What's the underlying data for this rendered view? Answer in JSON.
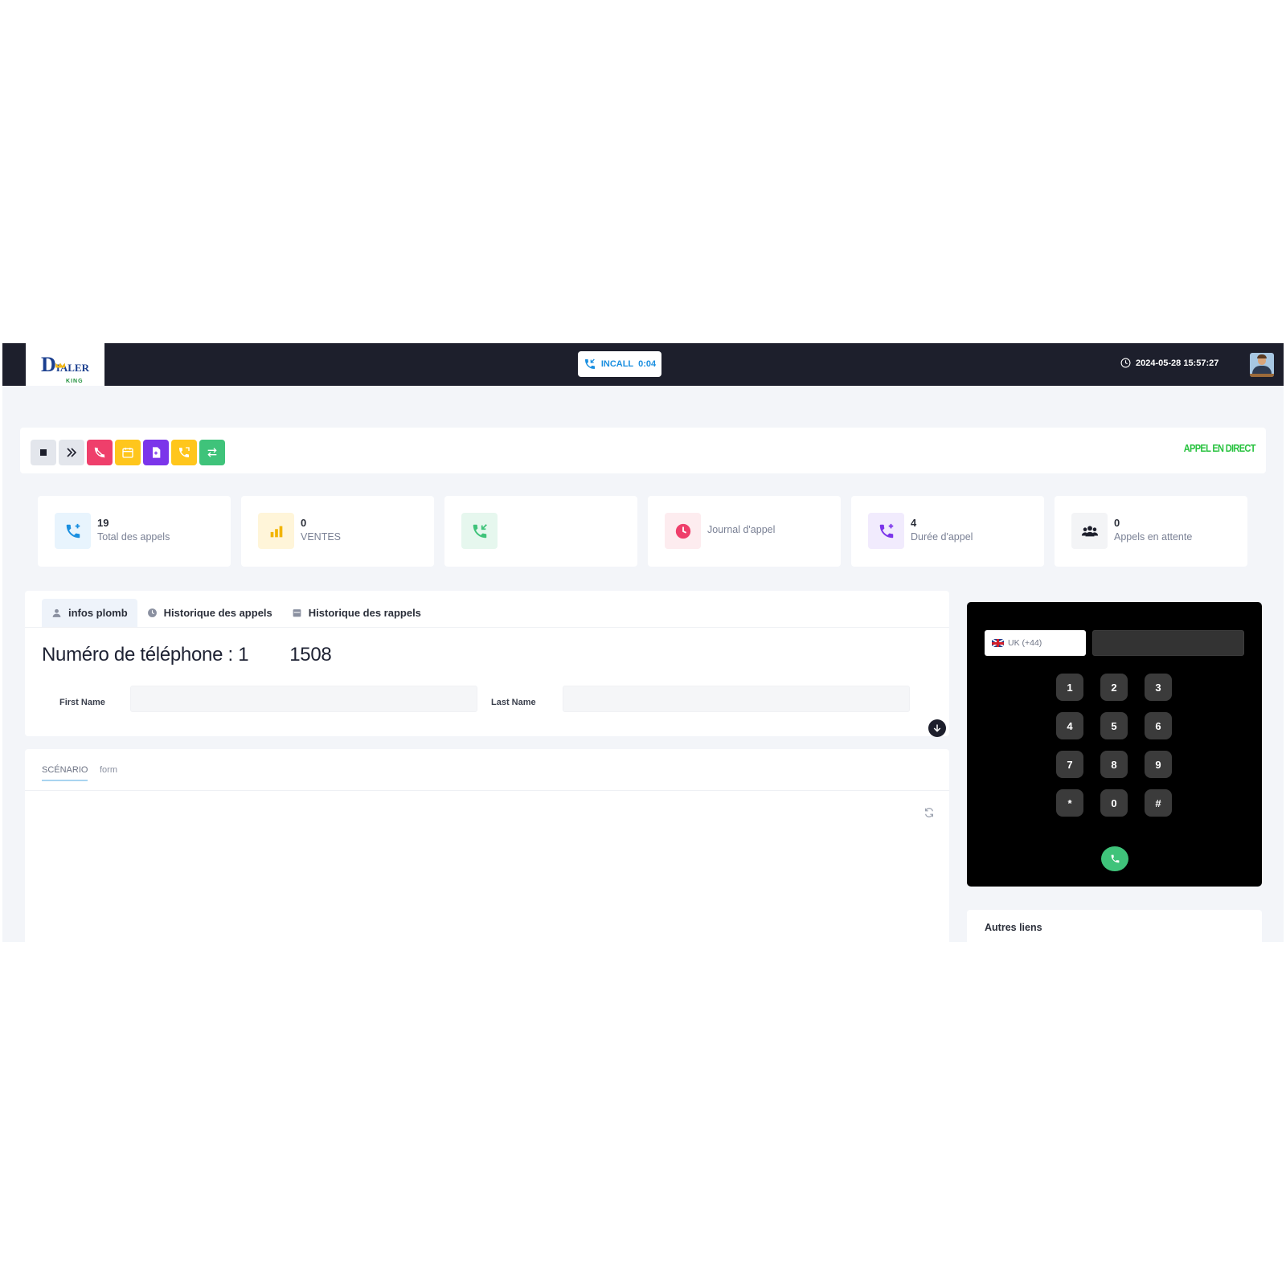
{
  "app": {
    "logo": {
      "main": "IALER",
      "sub": "KING",
      "initial": "D",
      "crown_color": "#f1b71b"
    },
    "status": {
      "label": "INCALL",
      "timer": "0:04",
      "color": "#1a8fe0"
    },
    "datetime": "2024-05-28 15:57:27",
    "avatar_icon": "user-avatar"
  },
  "toolbar": {
    "buttons": [
      {
        "name": "stop-button",
        "icon": "square-icon",
        "color": "#e3e6ec"
      },
      {
        "name": "skip-button",
        "icon": "double-chevron-right-icon",
        "color": "#e3e6ec"
      },
      {
        "name": "hangup-button",
        "icon": "phone-hangup-icon",
        "color": "#ef3f6b"
      },
      {
        "name": "calendar-button",
        "icon": "calendar-icon",
        "color": "#ffc61c"
      },
      {
        "name": "document-button",
        "icon": "document-icon",
        "color": "#7b35ea"
      },
      {
        "name": "callback-button",
        "icon": "phone-callback-icon",
        "color": "#ffc61c"
      },
      {
        "name": "transfer-button",
        "icon": "transfer-arrows-icon",
        "color": "#3fc37a"
      }
    ],
    "live_label": "APPEL EN DIRECT",
    "live_color": "#27c23e"
  },
  "stats": [
    {
      "value": "19",
      "label": "Total des appels",
      "icon": "phone-plus-icon",
      "color": "#1a8fe0",
      "bg": "#e8f4fd"
    },
    {
      "value": "0",
      "label": "VENTES",
      "icon": "bar-chart-icon",
      "color": "#f2b400",
      "bg": "#fff5d9"
    },
    {
      "value": "",
      "label": "",
      "icon": "phone-incoming-icon",
      "color": "#3fc37a",
      "bg": "#e6f7ee"
    },
    {
      "value": "",
      "label": "Journal d'appel",
      "icon": "clock-icon",
      "color": "#ef3f6b",
      "bg": "#fdecef"
    },
    {
      "value": "4",
      "label": "Durée d'appel",
      "icon": "phone-plus-icon",
      "color": "#7b35ea",
      "bg": "#f1ebfd"
    },
    {
      "value": "0",
      "label": "Appels en attente",
      "icon": "users-icon",
      "color": "#1d1f2c",
      "bg": "#f3f4f6"
    }
  ],
  "lead": {
    "tabs": [
      {
        "label": "infos plomb",
        "icon": "user-icon"
      },
      {
        "label": "Historique des appels",
        "icon": "clock-icon"
      },
      {
        "label": "Historique des rappels",
        "icon": "calendar-icon"
      }
    ],
    "phone_prefix": "Numéro de téléphone : 1",
    "phone_suffix": "1508",
    "first_name_label": "First Name",
    "first_name_value": "",
    "last_name_label": "Last Name",
    "last_name_value": ""
  },
  "scenario": {
    "tabs": [
      {
        "label": "SCÉNARIO"
      },
      {
        "label": "form"
      }
    ]
  },
  "dialer": {
    "country": "UK (+44)",
    "number_value": "",
    "keys": [
      "1",
      "2",
      "3",
      "4",
      "5",
      "6",
      "7",
      "8",
      "9",
      "*",
      "0",
      "#"
    ],
    "call_color": "#3fc37a"
  },
  "links": {
    "title": "Autres liens"
  }
}
